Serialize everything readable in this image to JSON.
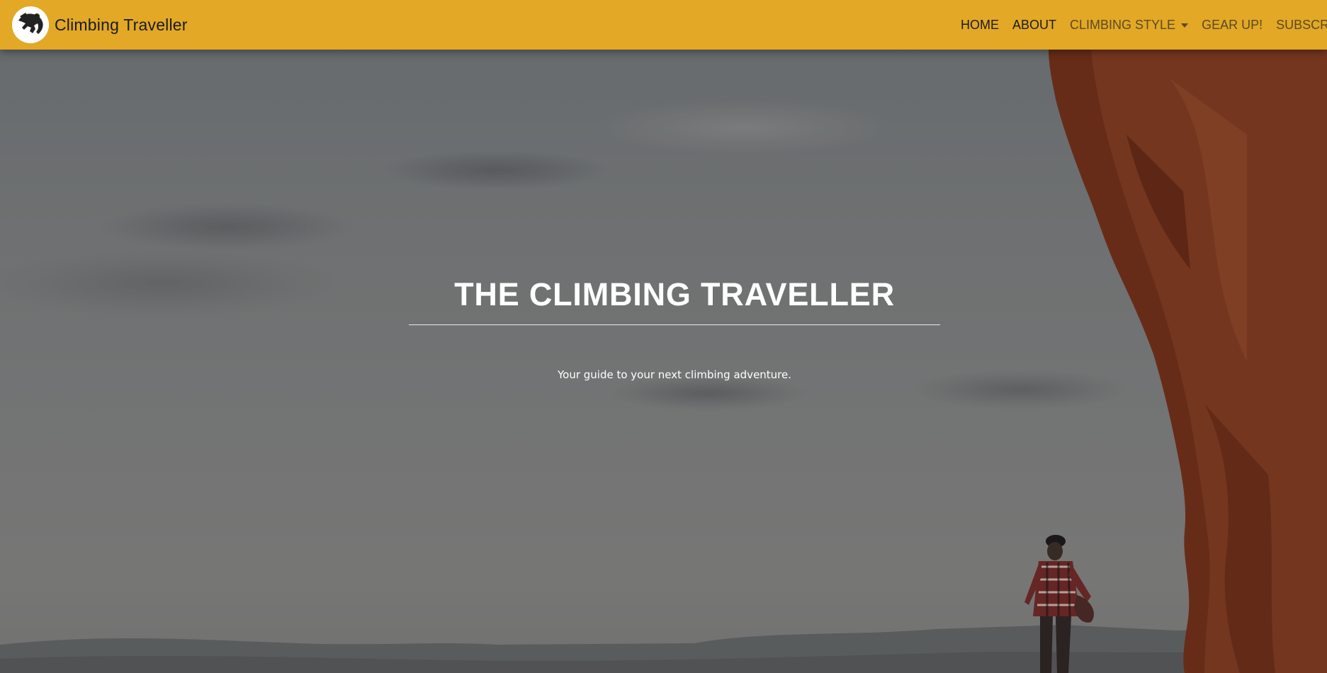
{
  "brand": {
    "logo_icon": "climber-silhouette-icon",
    "name": "Climbing Traveller"
  },
  "nav": {
    "items": [
      {
        "label": "HOME"
      },
      {
        "label": "ABOUT"
      },
      {
        "label": "CLIMBING STYLE",
        "dropdown": true
      },
      {
        "label": "GEAR UP!"
      },
      {
        "label": "SUBSCRIBE"
      }
    ]
  },
  "hero": {
    "title": "THE CLIMBING TRAVELLER",
    "subtitle": "Your guide to your next climbing adventure."
  },
  "colors": {
    "navbar": "#e2a826",
    "nav_text": "#1c1c1c",
    "nav_text_muted": "#5d4a21",
    "hero_text": "#ffffff",
    "rock": "#7a3a22"
  }
}
